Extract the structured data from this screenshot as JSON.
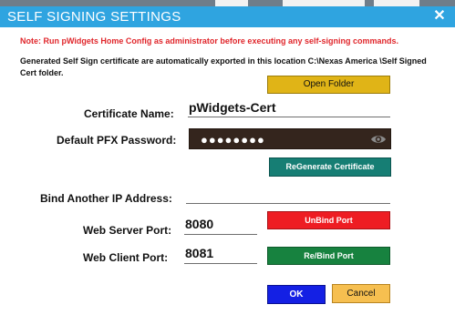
{
  "window": {
    "title": "SELF SIGNING SETTINGS",
    "close_symbol": "✕"
  },
  "note": "Note: Run pWidgets Home Config as administrator before executing any self-signing commands.",
  "info": "Generated Self Sign certificate are automatically exported in  this location C:\\Nexas America \\Self Signed Cert folder.",
  "buttons": {
    "open_folder": "Open Folder",
    "regenerate": "ReGenerate Certificate",
    "unbind": "UnBind Port",
    "rebind": "Re/Bind Port",
    "ok": "OK",
    "cancel": "Cancel"
  },
  "fields": {
    "certificate_name": {
      "label": "Certificate Name:",
      "value": "pWidgets-Cert"
    },
    "pfx_password": {
      "label": "Default PFX Password:",
      "masked": "●●●●●●●●"
    },
    "bind_ip": {
      "label": "Bind Another IP Address:",
      "value": ""
    },
    "web_server_port": {
      "label": "Web Server Port:",
      "value": "8080"
    },
    "web_client_port": {
      "label": "Web Client Port:",
      "value": "8081"
    }
  },
  "icons": {
    "close": "close-icon",
    "eye": "eye-icon"
  },
  "colors": {
    "titlebar": "#2fa4e0",
    "note_text": "#e0262b",
    "open_folder": "#e0b417",
    "regenerate": "#167e74",
    "unbind": "#ee1d23",
    "rebind": "#17823f",
    "ok": "#1420e4",
    "cancel": "#f6bf50",
    "password_box": "#34251d"
  }
}
